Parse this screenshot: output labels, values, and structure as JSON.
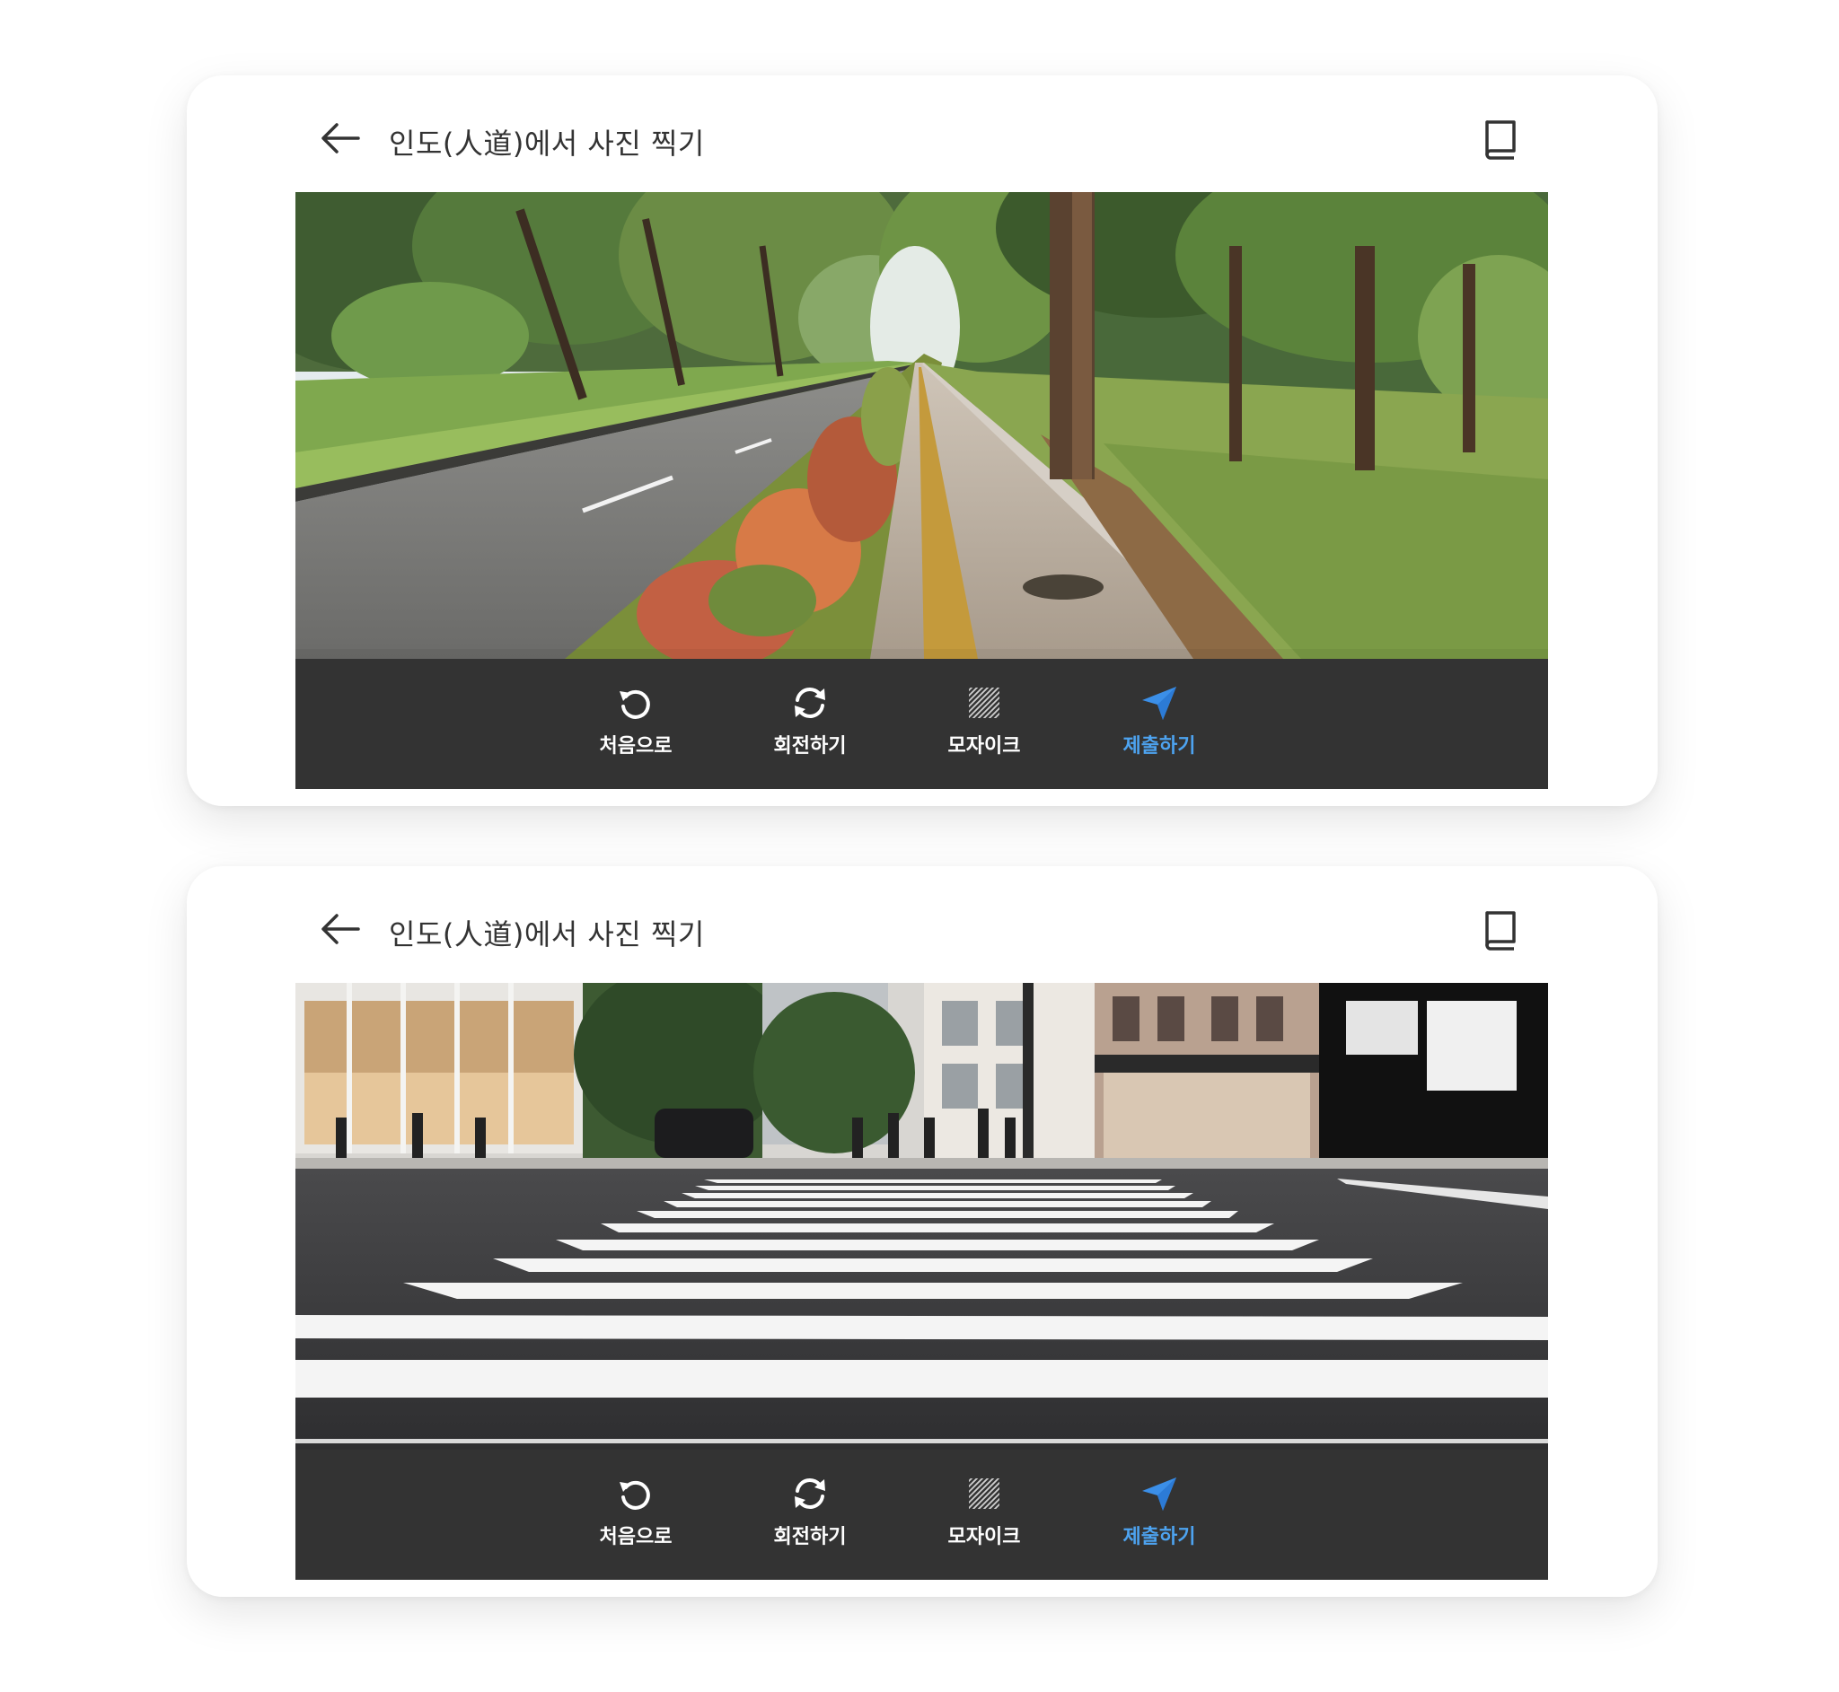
{
  "colors": {
    "card_background": "#ffffff",
    "toolbar_background": "#333333",
    "accent": "#3b8fe8",
    "title_text": "#333333"
  },
  "screens": [
    {
      "header": {
        "back_icon": "arrow-left-icon",
        "title": "인도(人道)에서 사진 찍기",
        "guide_icon": "book-icon"
      },
      "photo": {
        "subject": "sidewalk"
      },
      "toolbar": {
        "tools": [
          {
            "icon": "undo-icon",
            "label": "처음으로"
          },
          {
            "icon": "rotate-icon",
            "label": "회전하기"
          },
          {
            "icon": "mosaic-icon",
            "label": "모자이크"
          },
          {
            "icon": "send-icon",
            "label": "제출하기"
          }
        ]
      }
    },
    {
      "header": {
        "back_icon": "arrow-left-icon",
        "title": "인도(人道)에서 사진 찍기",
        "guide_icon": "book-icon"
      },
      "photo": {
        "subject": "crosswalk"
      },
      "toolbar": {
        "tools": [
          {
            "icon": "undo-icon",
            "label": "처음으로"
          },
          {
            "icon": "rotate-icon",
            "label": "회전하기"
          },
          {
            "icon": "mosaic-icon",
            "label": "모자이크"
          },
          {
            "icon": "send-icon",
            "label": "제출하기"
          }
        ]
      }
    }
  ]
}
